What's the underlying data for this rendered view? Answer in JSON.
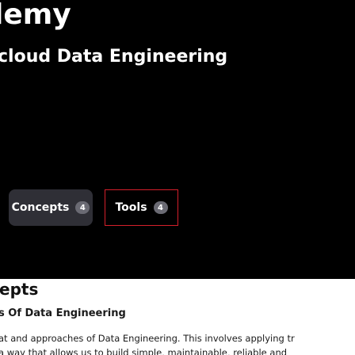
{
  "hero": {
    "brand": "lemy",
    "subtitle": "cloud Data Engineering"
  },
  "tabs": [
    {
      "label": "Concepts",
      "count": "4",
      "active": true
    },
    {
      "label": "Tools",
      "count": "4",
      "active": false
    }
  ],
  "section": {
    "title": "epts",
    "item_title": "s Of Data Engineering",
    "description_lines": [
      "at and approaches of Data Engineering. This involves applying tr",
      "a way that allows us to build simple, maintainable, reliable and"
    ]
  },
  "colors": {
    "hero_bg": "#000000",
    "active_tab_bg": "#2f2f36",
    "selected_tab_border": "#d51f2b",
    "badge_bg": "#6a6a73",
    "content_bg": "#ffffff"
  }
}
